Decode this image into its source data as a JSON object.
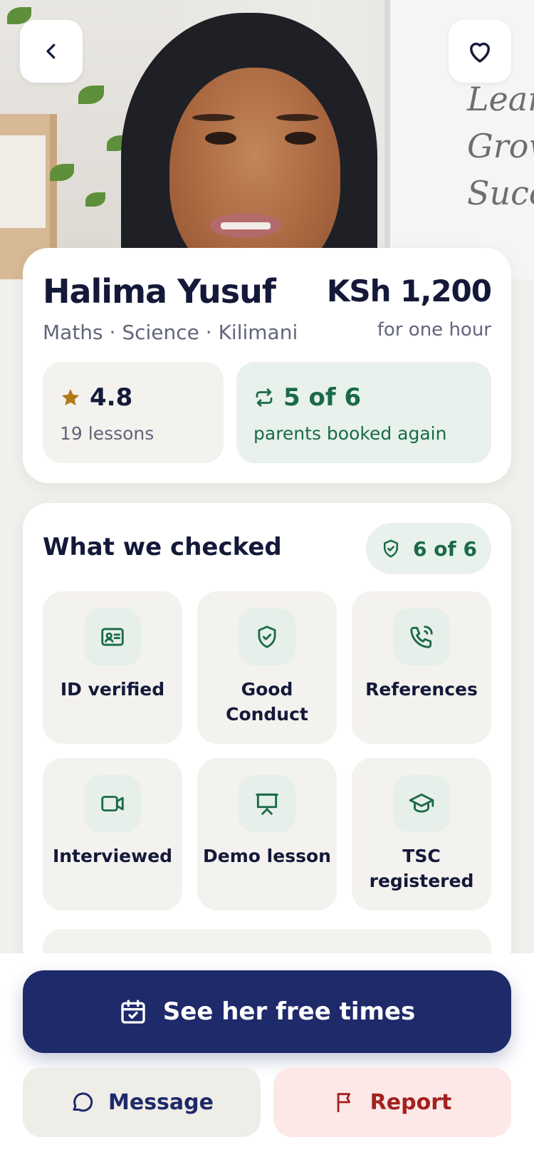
{
  "colors": {
    "navy": "#1f2a6b",
    "green": "#1a6a48",
    "report_red": "#a3211f",
    "star": "#b07a17"
  },
  "header": {
    "back_icon": "chevron-left-icon",
    "favorite_icon": "heart-outline-icon"
  },
  "hero": {
    "board_words": [
      "Lear",
      "Grow",
      "Succ"
    ]
  },
  "profile": {
    "name": "Halima Yusuf",
    "price": "KSh 1,200",
    "price_caption": "for one hour",
    "subjects": "Maths · Science · Kilimani",
    "rating": {
      "icon": "star-icon",
      "value": "4.8",
      "caption": "19 lessons"
    },
    "rebook": {
      "icon": "repeat-icon",
      "value": "5 of 6",
      "caption": "parents booked again"
    }
  },
  "checks": {
    "title": "What we checked",
    "badge_icon": "shield-check-icon",
    "badge": "6 of 6",
    "items": [
      {
        "label": "ID verified",
        "icon": "id-card-icon"
      },
      {
        "label": "Good Conduct",
        "icon": "shield-check-icon"
      },
      {
        "label": "References",
        "icon": "phone-icon"
      },
      {
        "label": "Interviewed",
        "icon": "video-icon"
      },
      {
        "label": "Demo lesson",
        "icon": "presentation-icon"
      },
      {
        "label": "TSC registered",
        "icon": "graduation-cap-icon"
      }
    ]
  },
  "actions": {
    "primary": {
      "label": "See her free times",
      "icon": "calendar-check-icon"
    },
    "message": {
      "label": "Message",
      "icon": "chat-bubble-icon"
    },
    "report": {
      "label": "Report",
      "icon": "flag-icon"
    }
  }
}
